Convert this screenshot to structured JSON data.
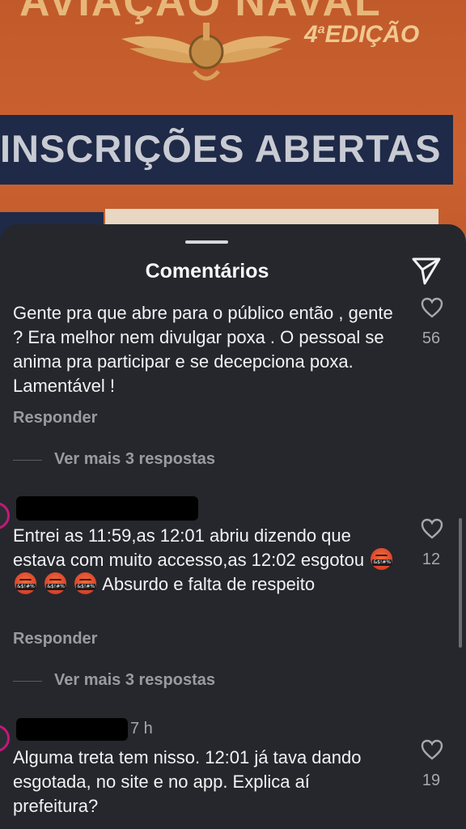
{
  "post": {
    "top_title": "AVIAÇÃO NAVAL",
    "edition": "4",
    "edition_sup": "a",
    "edition_word": "EDIÇÃO",
    "banner": "INSCRIÇÕES ABERTAS"
  },
  "sheet": {
    "title": "Comentários"
  },
  "comments": [
    {
      "text": "Gente pra que abre para o público então , gente ? Era melhor nem divulgar poxa . O pessoal se anima pra participar e se decepciona poxa.  Lamentável !",
      "likes": "56",
      "reply_label": "Responder",
      "more_replies": "Ver mais 3 respostas"
    },
    {
      "text_before": "Entrei as 11:59,as 12:01 abriu dizendo que estava com muito accesso,as 12:02 esgotou",
      "emoji_name": "face-with-symbols-on-mouth",
      "emoji_count": 4,
      "text_after": "Absurdo e falta de respeito",
      "likes": "12",
      "reply_label": "Responder",
      "more_replies": "Ver mais 3 respostas"
    },
    {
      "time": "7 h",
      "text": "Alguma treta tem nisso. 12:01 já tava dando esgotada, no site e no app. Explica aí prefeitura?",
      "likes": "19"
    }
  ],
  "icons": {
    "send": "paper-plane-icon",
    "like": "heart-outline-icon"
  },
  "colors": {
    "sheet_bg": "#25272c",
    "avatar_ring": "#c2187a",
    "post_orange": "#c15a2a",
    "banner_navy": "#1e2a47"
  }
}
